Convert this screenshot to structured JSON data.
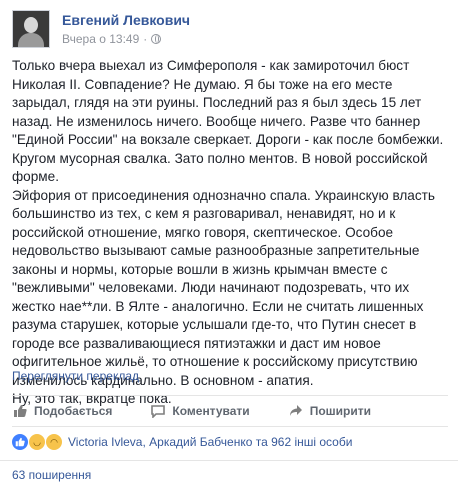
{
  "author": {
    "name": "Евгений Левкович"
  },
  "timestamp": "Вчера о 13:49",
  "privacy_icon": "globe-icon",
  "post_text": [
    "Только вчера выехал из Симферополя - как замироточил бюст Николая II. Совпадение? Не думаю. Я бы тоже на его месте зарыдал, глядя на эти руины. Последний раз я был здесь 15 лет назад. Не изменилось ничего. Вообще ничего. Разве что баннер \"Единой России\" на вокзале сверкает. Дороги - как после бомбежки. Кругом мусорная свалка. Зато полно ментов. В новой российской форме.",
    "Эйфория от присоединения однозначно спала. Украинскую власть большинство из тех, с кем я разговаривал, ненавидят, но и к российской отношение, мягко говоря, скептическое. Особое недовольство вызывают самые разнообразные запретительные законы и нормы, которые вошли в жизнь крымчан вместе с \"вежливыми\" человеками. Люди начинают подозревать, что их жестко нае**ли. В Ялте - аналогично. Если не считать лишенных разума старушек, которые услышали где-то, что Путин снесет в городе все разваливающиеся пятиэтажки и даст им новое офигительное жильё, то отношение к российскому присутствию изменилось кардинально. В основном - апатия.",
    "Ну, это так, вкратце пока."
  ],
  "translate_link": "Переглянути переклад",
  "actions": {
    "like": "Подобається",
    "comment": "Коментувати",
    "share": "Поширити"
  },
  "reactions": {
    "icons": [
      "like-icon",
      "haha-icon",
      "sad-icon"
    ],
    "summary": "Victoria Ivleva, Аркадий Бабченко та 962 інші особи"
  },
  "shares": "63 поширення",
  "colors": {
    "link": "#365899",
    "like_blue": "#4080ff",
    "text": "#1d2129",
    "muted": "#90949c"
  }
}
